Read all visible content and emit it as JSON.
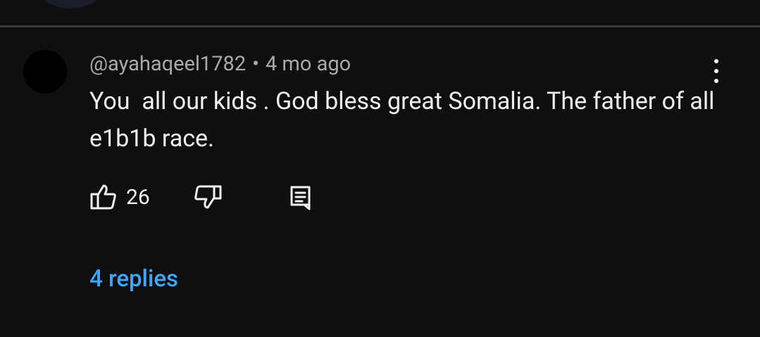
{
  "comment": {
    "author": "@ayahaqeel1782",
    "separator": "•",
    "time_ago": "4 mo ago",
    "text": "You  all our kids . God bless great Somalia. The father of all e1b1b race.",
    "like_count": "26",
    "replies_label": "4 replies"
  },
  "icons": {
    "like": "thumbs-up-icon",
    "dislike": "thumbs-down-icon",
    "reply": "reply-comment-icon",
    "more": "more-vertical-icon"
  },
  "colors": {
    "background": "#0f0f0f",
    "text": "#f1f1f1",
    "secondary_text": "#aaaaaa",
    "link": "#3ea6ff",
    "divider": "#3a3a3a"
  }
}
